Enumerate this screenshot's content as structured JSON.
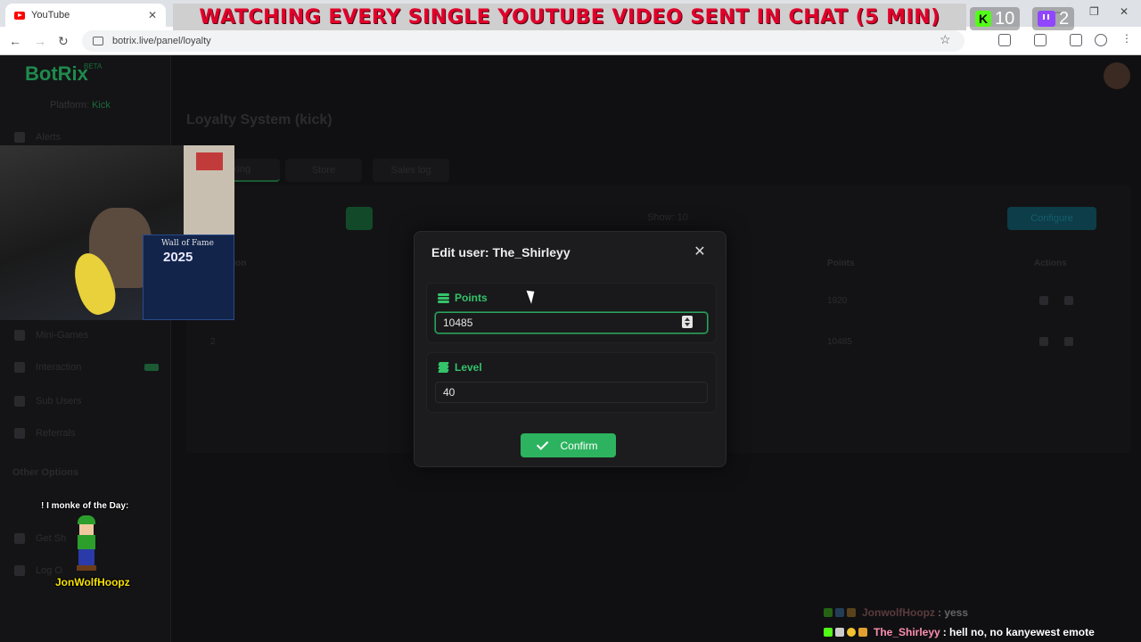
{
  "browser": {
    "tab_title": "YouTube",
    "url": "botrix.live/panel/loyalty"
  },
  "stream_banner": {
    "text": "WATCHING EVERY SINGLE YOUTUBE VIDEO SENT IN CHAT (5 MIN)",
    "kick_viewers": "10",
    "twitch_viewers": "2"
  },
  "app": {
    "logo": "BotRix",
    "logo_badge": "BETA",
    "platform_label": "Platform:",
    "platform_value": "Kick",
    "sidebar": {
      "items": [
        "Alerts",
        "Mini-Games",
        "Interaction",
        "Sub Users",
        "Referrals"
      ],
      "section_heading": "Other Options",
      "bottom_items": [
        "Get Sh",
        "Log O"
      ]
    },
    "page_title": "Loyalty System (kick)",
    "tabs": [
      "king",
      "Store",
      "Sales log"
    ],
    "show_label": "Show",
    "show_value": "10",
    "configure_label": "Configure",
    "columns": [
      "tion",
      "Points",
      "Actions"
    ],
    "rows": [
      {
        "rank": "",
        "points": "1920"
      },
      {
        "rank": "2",
        "points": "10485"
      }
    ]
  },
  "modal": {
    "title": "Edit user: The_Shirleyy",
    "points_label": "Points",
    "points_value": "10485",
    "level_label": "Level",
    "level_value": "40",
    "confirm_label": "Confirm"
  },
  "overlay": {
    "poster_title": "Wall of Fame",
    "poster_year": "2025",
    "monke_title": "! I monke of the Day:",
    "monke_name": "JonWolfHoopz"
  },
  "chat": [
    {
      "user": "JonwolfHoopz",
      "message": ": yess",
      "user_color": "#e08a8a",
      "dim": true
    },
    {
      "user": "The_Shirleyy",
      "message": ": hell no, no kanyewest emote",
      "user_color": "#ff8fb0",
      "dim": false
    }
  ],
  "colors": {
    "accent_green": "#2db35f",
    "kick_green": "#53fc18",
    "twitch_purple": "#9146ff",
    "banner_red": "#e1002a"
  },
  "icons": [
    "youtube-icon",
    "coins-icon",
    "layers-icon",
    "check-icon",
    "close-icon",
    "kick-icon",
    "twitch-icon"
  ]
}
